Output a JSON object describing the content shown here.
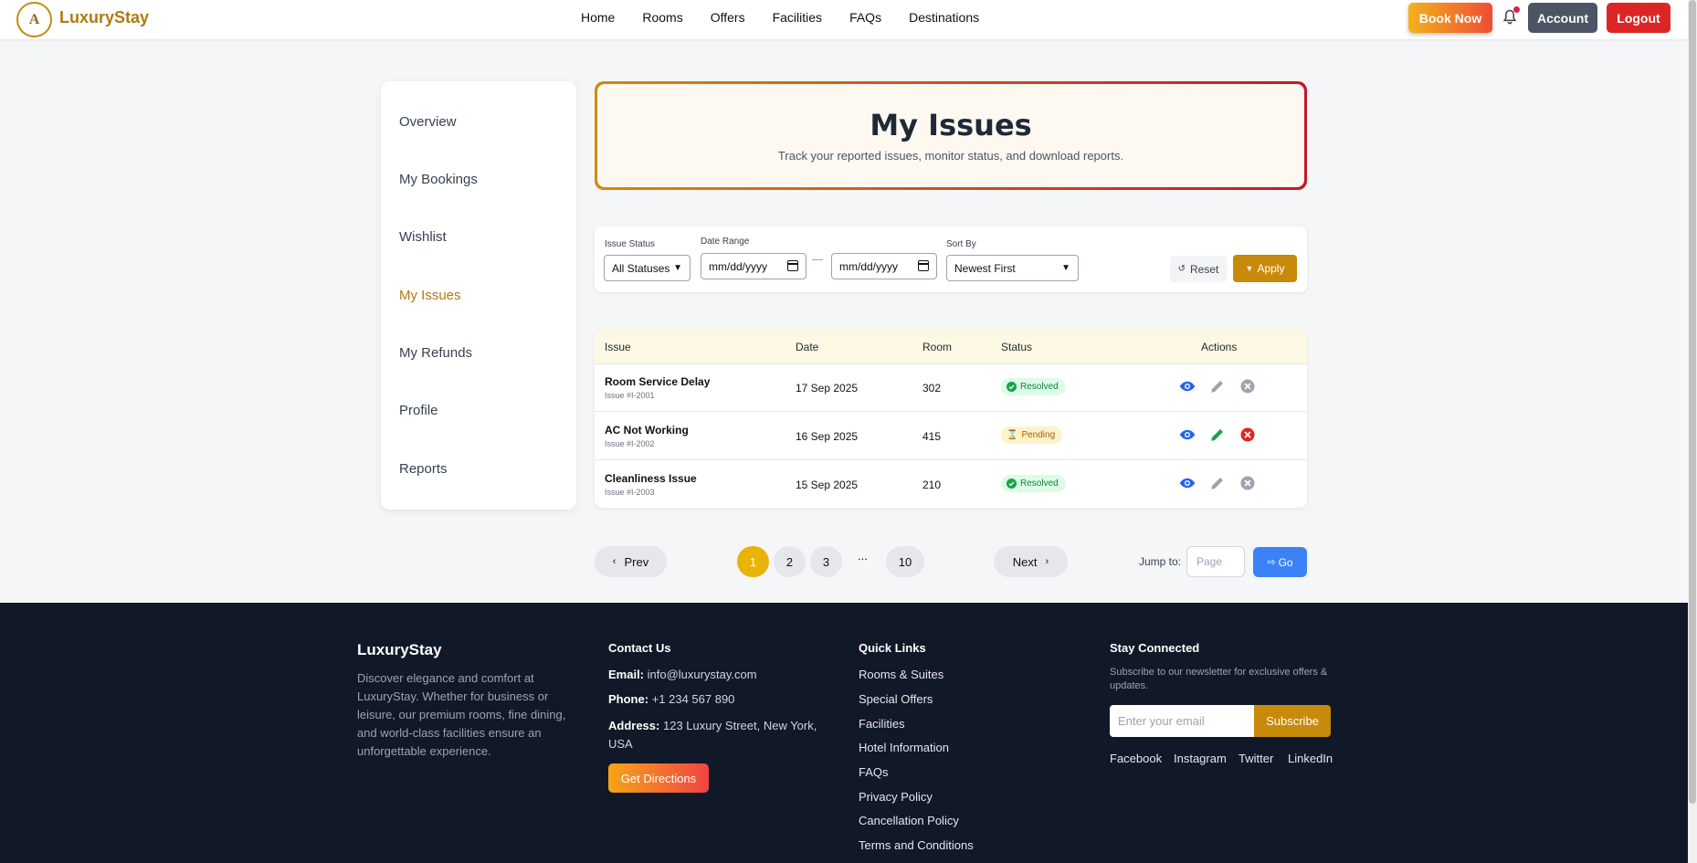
{
  "header": {
    "brand": "LuxuryStay",
    "logo_letter": "A",
    "nav": [
      "Home",
      "Rooms",
      "Offers",
      "Facilities",
      "FAQs",
      "Destinations"
    ],
    "book_now": "Book Now",
    "account": "Account",
    "logout": "Logout"
  },
  "sidebar": {
    "items": [
      "Overview",
      "My Bookings",
      "Wishlist",
      "My Issues",
      "My Refunds",
      "Profile",
      "Reports"
    ],
    "active": "My Issues"
  },
  "hero": {
    "title": "My Issues",
    "subtitle": "Track your reported issues, monitor status, and download reports."
  },
  "filters": {
    "status_label": "Issue Status",
    "status_value": "All Statuses",
    "date_label": "Date Range",
    "date_from_placeholder": "mm/dd/yyyy",
    "date_to_placeholder": "mm/dd/yyyy",
    "sort_label": "Sort By",
    "sort_value": "Newest First",
    "reset": "Reset",
    "apply": "Apply"
  },
  "table": {
    "headers": [
      "Issue",
      "Date",
      "Room",
      "Status",
      "Actions"
    ],
    "rows": [
      {
        "title": "Room Service Delay",
        "id": "Issue #I-2001",
        "date": "17 Sep 2025",
        "room": "302",
        "status": "Resolved",
        "status_color": "#15803d"
      },
      {
        "title": "AC Not Working",
        "id": "Issue #I-2002",
        "date": "16 Sep 2025",
        "room": "415",
        "status": "Pending",
        "status_color": "#a16207"
      },
      {
        "title": "Cleanliness Issue",
        "id": "Issue #I-2003",
        "date": "15 Sep 2025",
        "room": "210",
        "status": "Resolved",
        "status_color": "#15803d"
      }
    ]
  },
  "pagination": {
    "prev": "Prev",
    "pages": [
      "1",
      "2",
      "3"
    ],
    "ellipsis": "...",
    "last": "10",
    "current": "1",
    "next": "Next",
    "jump_label": "Jump to:",
    "jump_placeholder": "Page",
    "go": "Go"
  },
  "footer": {
    "brand": "LuxuryStay",
    "description": "Discover elegance and comfort at LuxuryStay. Whether for business or leisure, our premium rooms, fine dining, and world-class facilities ensure an unforgettable experience.",
    "contact_heading": "Contact Us",
    "email_label": "Email:",
    "email": "info@luxurystay.com",
    "phone_label": "Phone:",
    "phone": "+1 234 567 890",
    "address_label": "Address:",
    "address": "123 Luxury Street, New York, USA",
    "directions": "Get Directions",
    "links_heading": "Quick Links",
    "links": [
      "Rooms & Suites",
      "Special Offers",
      "Facilities",
      "Hotel Information",
      "FAQs",
      "Privacy Policy",
      "Cancellation Policy",
      "Terms and Conditions"
    ],
    "connect_heading": "Stay Connected",
    "newsletter": "Subscribe to our newsletter for exclusive offers & updates.",
    "email_placeholder": "Enter your email",
    "subscribe": "Subscribe",
    "social": [
      "Facebook",
      "Instagram",
      "Twitter",
      "LinkedIn"
    ]
  },
  "colors": {
    "brand": "#b07a10",
    "accent": "#c88a0a",
    "danger": "#dc2626",
    "primary_blue": "#3b82f6",
    "footer_bg": "#111827"
  }
}
